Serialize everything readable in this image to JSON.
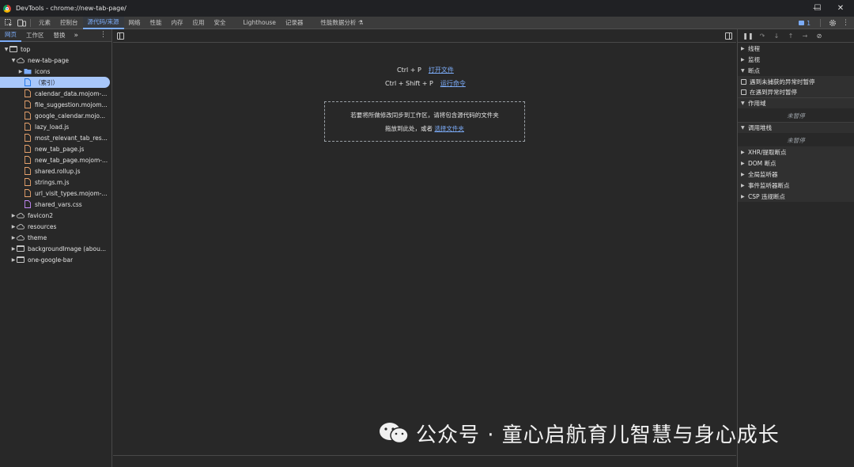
{
  "window": {
    "title": "DevTools - chrome://new-tab-page/",
    "minimize": "—",
    "maximize": "☐",
    "close": "✕"
  },
  "toolbar": {
    "tabs": [
      {
        "label": "元素"
      },
      {
        "label": "控制台"
      },
      {
        "label": "源代码/来源",
        "active": true
      },
      {
        "label": "网络"
      },
      {
        "label": "性能"
      },
      {
        "label": "内存"
      },
      {
        "label": "应用"
      },
      {
        "label": "安全"
      },
      {
        "label": "Lighthouse"
      },
      {
        "label": "记录器"
      },
      {
        "label": "性能数据分析 ⚗"
      }
    ],
    "issues_count": "1",
    "accent_color": "#7cacf8"
  },
  "navigator": {
    "tabs": [
      "网页",
      "工作区",
      "替换"
    ],
    "more": "»",
    "tree": [
      {
        "label": "top",
        "depth": 0,
        "expanded": true,
        "icon": "frame-icon"
      },
      {
        "label": "new-tab-page",
        "depth": 1,
        "expanded": true,
        "icon": "cloud-icon"
      },
      {
        "label": "icons",
        "depth": 2,
        "expanded": false,
        "icon": "folder-icon"
      },
      {
        "label": "（索引）",
        "depth": 2,
        "icon": "document-icon",
        "selected": true
      },
      {
        "label": "calendar_data.mojom-...",
        "depth": 2,
        "icon": "script-file-icon"
      },
      {
        "label": "file_suggestion.mojom...",
        "depth": 2,
        "icon": "script-file-icon"
      },
      {
        "label": "google_calendar.mojo...",
        "depth": 2,
        "icon": "script-file-icon"
      },
      {
        "label": "lazy_load.js",
        "depth": 2,
        "icon": "script-file-icon"
      },
      {
        "label": "most_relevant_tab_res...",
        "depth": 2,
        "icon": "script-file-icon"
      },
      {
        "label": "new_tab_page.js",
        "depth": 2,
        "icon": "script-file-icon"
      },
      {
        "label": "new_tab_page.mojom-...",
        "depth": 2,
        "icon": "script-file-icon"
      },
      {
        "label": "shared.rollup.js",
        "depth": 2,
        "icon": "script-file-icon"
      },
      {
        "label": "strings.m.js",
        "depth": 2,
        "icon": "script-file-icon"
      },
      {
        "label": "url_visit_types.mojom-...",
        "depth": 2,
        "icon": "script-file-icon"
      },
      {
        "label": "shared_vars.css",
        "depth": 2,
        "icon": "stylesheet-file-icon"
      },
      {
        "label": "favicon2",
        "depth": 1,
        "expanded": false,
        "icon": "cloud-icon"
      },
      {
        "label": "resources",
        "depth": 1,
        "expanded": false,
        "icon": "cloud-icon"
      },
      {
        "label": "theme",
        "depth": 1,
        "expanded": false,
        "icon": "cloud-icon"
      },
      {
        "label": "backgroundImage (abou...",
        "depth": 1,
        "expanded": false,
        "icon": "frame-icon"
      },
      {
        "label": "one-google-bar",
        "depth": 1,
        "expanded": false,
        "icon": "frame-icon"
      }
    ]
  },
  "editor": {
    "shortcut1_keys": "Ctrl + P",
    "shortcut1_action": "打开文件",
    "shortcut2_keys": "Ctrl + Shift + P",
    "shortcut2_action": "运行命令",
    "drop_line1": "若要将所做修改同步到工作区，请将包含源代码的文件夹",
    "drop_line2_prefix": "拖放到此处，或者",
    "drop_link": "选择文件夹"
  },
  "debugger": {
    "sections": [
      {
        "label": "线程",
        "expanded": false
      },
      {
        "label": "监视",
        "expanded": false
      },
      {
        "label": "断点",
        "expanded": true
      }
    ],
    "checkbox1": "遇到未捕获的异常时暂停",
    "checkbox2": "在遇到异常时暂停",
    "scope_label": "作用域",
    "scope_note": "未暂停",
    "callstack_label": "调用堆栈",
    "callstack_note": "未暂停",
    "more_sections": [
      {
        "label": "XHR/提取断点"
      },
      {
        "label": "DOM 断点"
      },
      {
        "label": "全局监听器"
      },
      {
        "label": "事件监听器断点"
      },
      {
        "label": "CSP 违规断点"
      }
    ]
  },
  "watermark": {
    "text": "公众号 · 童心启航育儿智慧与身心成长"
  }
}
